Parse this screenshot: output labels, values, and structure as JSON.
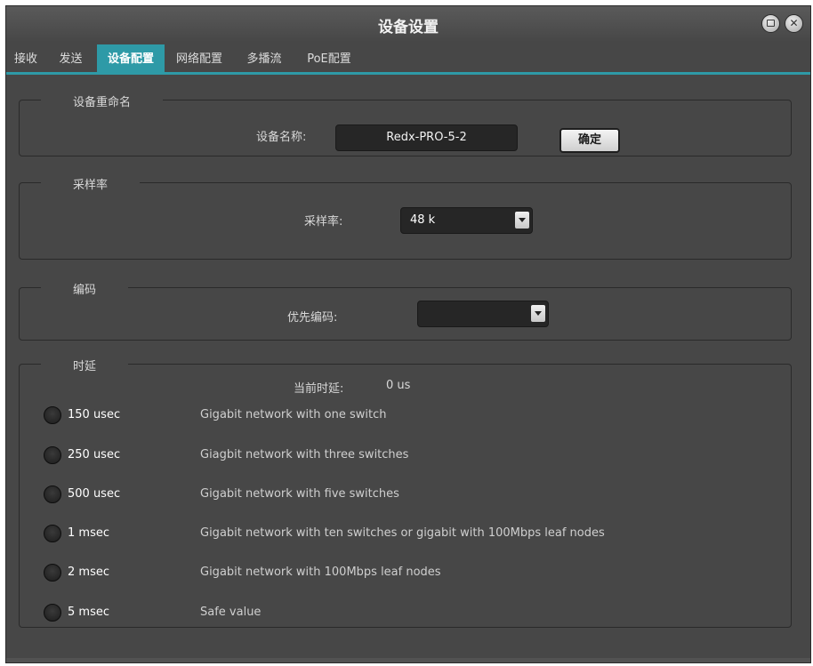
{
  "window": {
    "title": "设备设置"
  },
  "tabs": [
    {
      "label": "接收",
      "active": false
    },
    {
      "label": "发送",
      "active": false
    },
    {
      "label": "设备配置",
      "active": true
    },
    {
      "label": "网络配置",
      "active": false
    },
    {
      "label": "多播流",
      "active": false
    },
    {
      "label": "PoE配置",
      "active": false
    }
  ],
  "rename": {
    "group_title": "设备重命名",
    "field_label": "设备名称:",
    "value": "Redx-PRO-5-2",
    "confirm_label": "确定"
  },
  "sample_rate": {
    "group_title": "采样率",
    "field_label": "采样率:",
    "selected": "48 k"
  },
  "encoding": {
    "group_title": "编码",
    "field_label": "优先编码:",
    "selected": ""
  },
  "latency": {
    "group_title": "时延",
    "current_label": "当前时延:",
    "current_value": "0 us",
    "options": [
      {
        "label": "150 usec",
        "desc": "Gigabit network with one switch"
      },
      {
        "label": "250 usec",
        "desc": "Giagbit network with three switches"
      },
      {
        "label": "500 usec",
        "desc": "Gigabit network with five switches"
      },
      {
        "label": "1 msec",
        "desc": "Gigabit network with ten switches or gigabit with 100Mbps leaf nodes"
      },
      {
        "label": "2 msec",
        "desc": "Gigabit network with 100Mbps leaf nodes"
      },
      {
        "label": "5 msec",
        "desc": "Safe value"
      }
    ]
  },
  "colors": {
    "accent": "#2e9aa7",
    "background": "#474747",
    "field": "#262626"
  }
}
